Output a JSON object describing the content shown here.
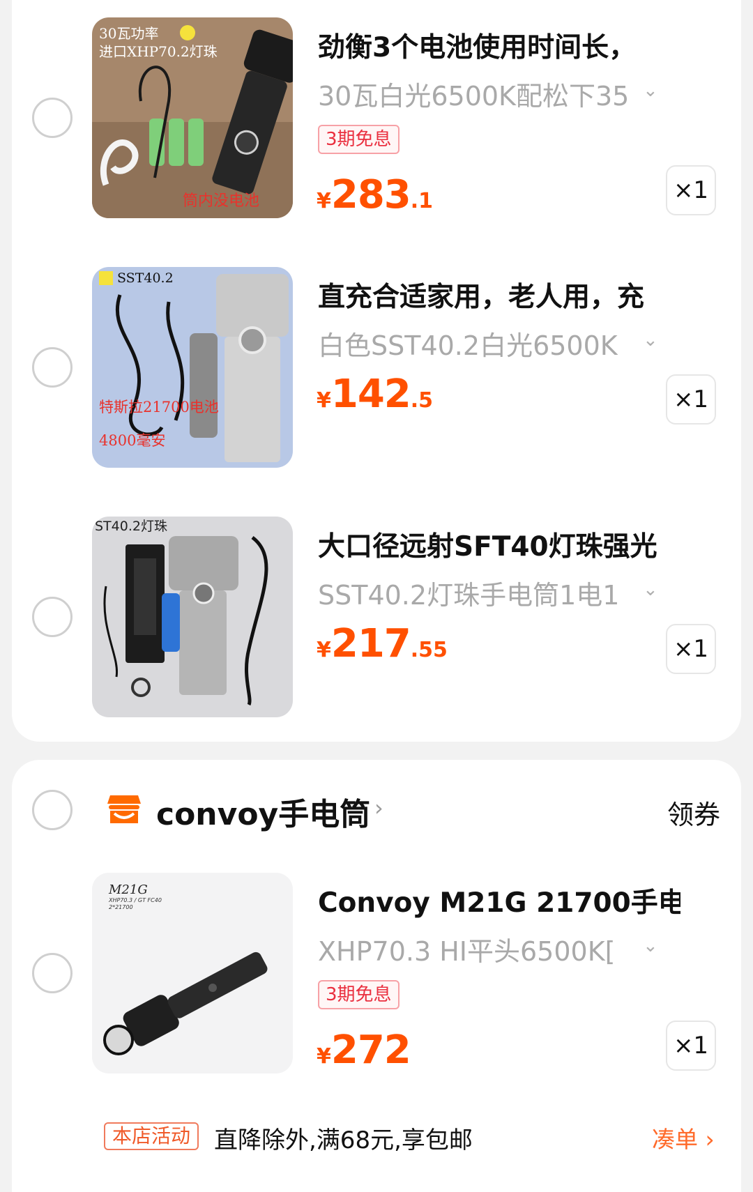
{
  "items": [
    {
      "title": "劲衡3个电池使用时间长，",
      "spec": "30瓦白光6500K配松下35",
      "badge": "3期免息",
      "price_yen": "¥",
      "price_int": "283",
      "price_dec": ".1",
      "qty": "×1",
      "image_text": [
        "30瓦功率",
        "进口XHP70.2灯珠",
        "筒内没电池"
      ]
    },
    {
      "title": "直充合适家用，老人用，充",
      "spec": "白色SST40.2白光6500K",
      "price_yen": "¥",
      "price_int": "142",
      "price_dec": ".5",
      "qty": "×1",
      "image_text": [
        "SST40.2",
        "特斯拉21700电池",
        "4800毫安"
      ]
    },
    {
      "title": "大口径远射SFT40灯珠强光",
      "spec": "SST40.2灯珠手电筒1电1",
      "price_yen": "¥",
      "price_int": "217",
      "price_dec": ".55",
      "qty": "×1",
      "image_text": [
        "ST40.2灯珠"
      ]
    }
  ],
  "store": {
    "name": "convoy手电筒",
    "chevron": "›",
    "coupon": "领券",
    "icon": "store-icon",
    "items": [
      {
        "title": "Convoy M21G 21700手电",
        "spec": "XHP70.3 HI平头6500K[",
        "badge": "3期免息",
        "price_yen": "¥",
        "price_int": "272",
        "price_dec": "",
        "qty": "×1",
        "image_text": [
          "M21G",
          "XHP70.3 / GT FC40",
          "2*21700"
        ]
      }
    ],
    "promo": {
      "tag": "本店活动",
      "text": "直降除外,满68元,享包邮",
      "link": "凑单 ›"
    }
  },
  "colors": {
    "price": "#ff5000",
    "badge": "#ea2f3f",
    "accent": "#ff6a2a"
  }
}
